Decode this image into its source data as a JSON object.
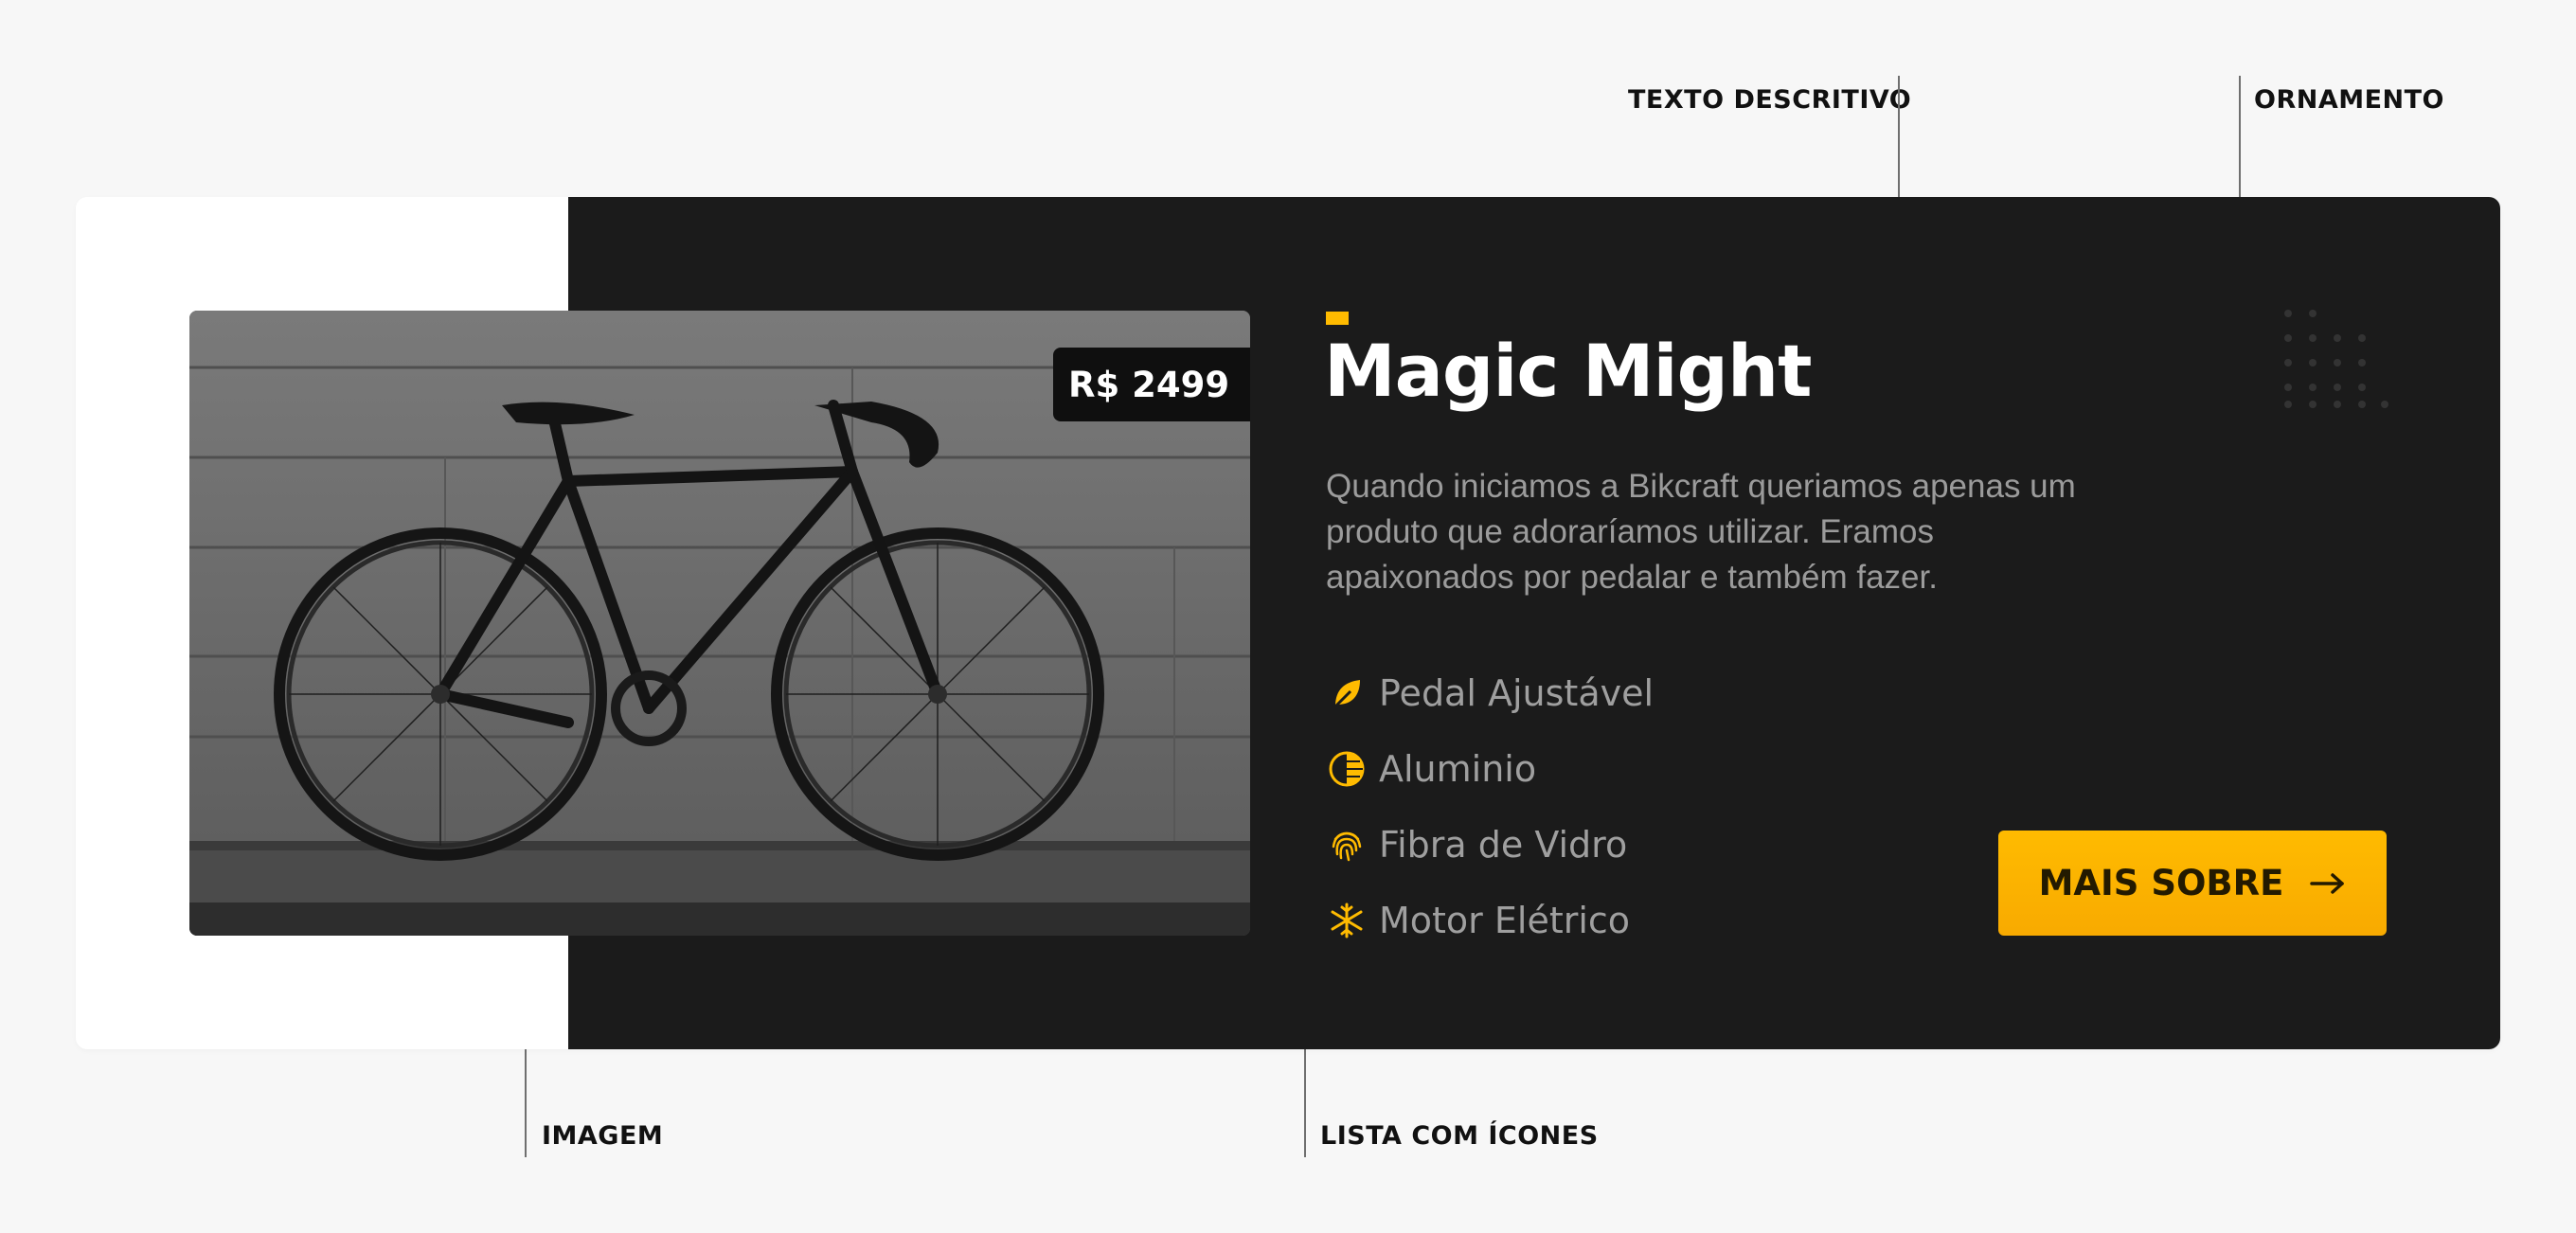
{
  "annotations": {
    "texto": "TEXTO DESCRITIVO",
    "ornamento": "ORNAMENTO",
    "imagem": "IMAGEM",
    "lista": "LISTA COM ÍCONES"
  },
  "product": {
    "price": "R$ 2499",
    "title": "Magic Might",
    "description": "Quando iniciamos a Bikcraft queriamos apenas um produto que adoraríamos utilizar. Eramos apaixonados por pedalar e também fazer.",
    "features": [
      {
        "icon": "leaf-icon",
        "label": "Pedal Ajustável"
      },
      {
        "icon": "half-circle-icon",
        "label": "Aluminio"
      },
      {
        "icon": "fingerprint-icon",
        "label": "Fibra de Vidro"
      },
      {
        "icon": "snowflake-icon",
        "label": "Motor Elétrico"
      }
    ],
    "button_label": "MAIS SOBRE"
  },
  "colors": {
    "accent": "#ffbb00",
    "dark": "#1b1b1b",
    "muted_text": "#9b9b9b"
  }
}
